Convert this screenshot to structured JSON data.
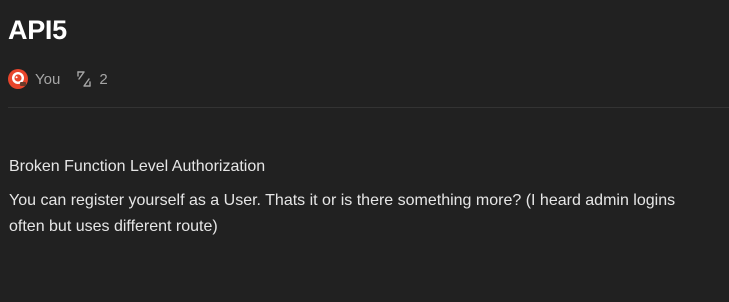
{
  "document": {
    "title": "API5",
    "author": "You",
    "revisions": "2",
    "subtitle": "Broken Function Level Authorization",
    "body": "You can register yourself as a User. Thats it or is there something more? (I heard admin logins often but uses different route)"
  },
  "icons": {
    "avatar": "avatar-icon",
    "revisions": "revision-arrows-icon"
  },
  "colors": {
    "background": "#212121",
    "avatar_accent": "#e8452c"
  }
}
